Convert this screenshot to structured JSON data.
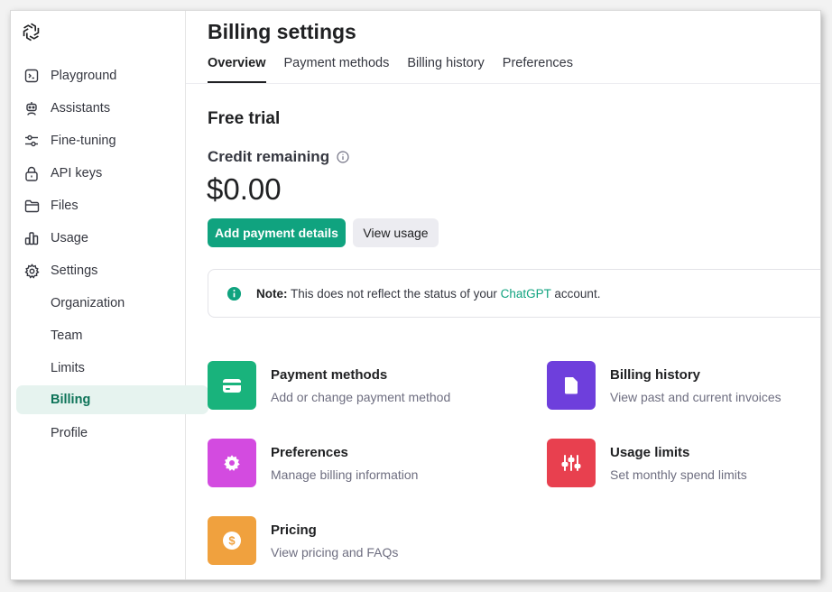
{
  "sidebar": {
    "items": [
      {
        "label": "Playground",
        "icon": "terminal-icon"
      },
      {
        "label": "Assistants",
        "icon": "robot-icon"
      },
      {
        "label": "Fine-tuning",
        "icon": "sliders-icon"
      },
      {
        "label": "API keys",
        "icon": "lock-icon"
      },
      {
        "label": "Files",
        "icon": "folder-icon"
      },
      {
        "label": "Usage",
        "icon": "bar-chart-icon"
      },
      {
        "label": "Settings",
        "icon": "gear-icon"
      }
    ],
    "settings_sub": [
      {
        "label": "Organization"
      },
      {
        "label": "Team"
      },
      {
        "label": "Limits"
      },
      {
        "label": "Billing",
        "active": true
      },
      {
        "label": "Profile"
      }
    ]
  },
  "header": {
    "title": "Billing settings",
    "tabs": [
      {
        "label": "Overview",
        "active": true
      },
      {
        "label": "Payment methods"
      },
      {
        "label": "Billing history"
      },
      {
        "label": "Preferences"
      }
    ]
  },
  "overview": {
    "section_title": "Free trial",
    "credit_label": "Credit remaining",
    "credit_value": "$0.00",
    "primary_button": "Add payment details",
    "secondary_button": "View usage"
  },
  "note": {
    "prefix": "Note:",
    "text_before": " This does not reflect the status of your ",
    "link": "ChatGPT",
    "text_after": " account."
  },
  "cards": [
    {
      "title": "Payment methods",
      "desc": "Add or change payment method",
      "color": "#19b37c",
      "icon": "credit-card-icon"
    },
    {
      "title": "Billing history",
      "desc": "View past and current invoices",
      "color": "#6e3fdc",
      "icon": "document-icon"
    },
    {
      "title": "Preferences",
      "desc": "Manage billing information",
      "color": "#d34be0",
      "icon": "gear-icon"
    },
    {
      "title": "Usage limits",
      "desc": "Set monthly spend limits",
      "color": "#e8404f",
      "icon": "sliders-icon"
    },
    {
      "title": "Pricing",
      "desc": "View pricing and FAQs",
      "color": "#f0a13e",
      "icon": "dollar-coin-icon"
    }
  ],
  "colors": {
    "accent": "#10a37f",
    "active_nav_bg": "#e6f3ef",
    "active_nav_text": "#0d7358"
  }
}
